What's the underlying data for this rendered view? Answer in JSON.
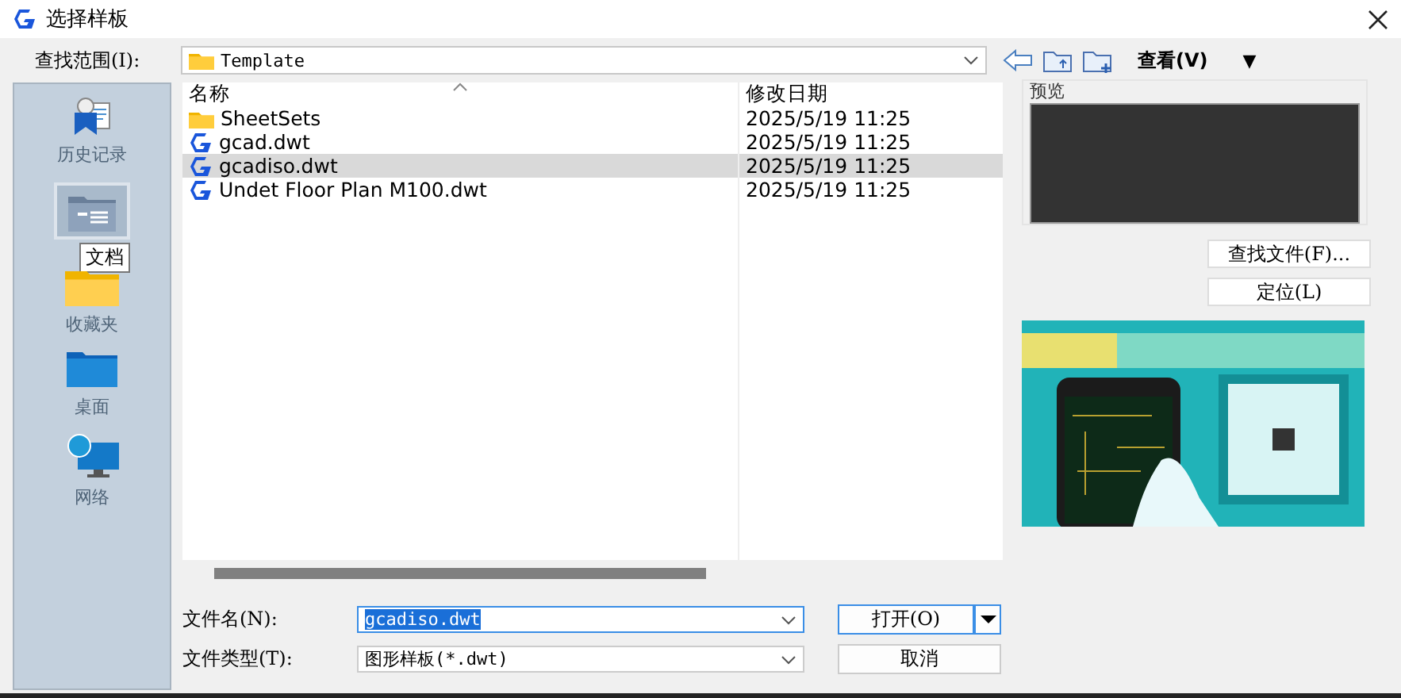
{
  "window": {
    "title": "选择样板"
  },
  "look_in": {
    "label": "查找范围(I):",
    "value": "Template",
    "view_label": "查看(V)",
    "view_menu": "▼"
  },
  "sidebar": {
    "items": [
      {
        "kind": "history",
        "label": "历史记录",
        "selected": false
      },
      {
        "kind": "documents",
        "selected": true
      },
      {
        "kind": "favorites",
        "label": "收藏夹",
        "selected": false
      },
      {
        "kind": "desktop",
        "label": "桌面",
        "selected": false
      },
      {
        "kind": "network",
        "label": "网络",
        "selected": false
      }
    ],
    "tooltip": "文档"
  },
  "file_list": {
    "columns": [
      "名称",
      "修改日期"
    ],
    "rows": [
      {
        "kind": "folder",
        "name": "SheetSets",
        "date": "2025/5/19 11:25",
        "selected": false
      },
      {
        "kind": "dwt",
        "name": "gcad.dwt",
        "date": "2025/5/19 11:25",
        "selected": false
      },
      {
        "kind": "dwt",
        "name": "gcadiso.dwt",
        "date": "2025/5/19 11:25",
        "selected": true
      },
      {
        "kind": "dwt",
        "name": "Undet Floor Plan M100.dwt",
        "date": "2025/5/19 11:25",
        "selected": false
      }
    ]
  },
  "preview": {
    "label": "预览"
  },
  "side_buttons": [
    "查找文件(F)...",
    "定位(L)"
  ],
  "form": {
    "file_name_label": "文件名(N):",
    "file_name": "gcadiso.dwt",
    "file_type_label": "文件类型(T):",
    "file_type": "图形样板(*.dwt)"
  },
  "buttons": {
    "open": "打开(O)",
    "cancel": "取消"
  }
}
